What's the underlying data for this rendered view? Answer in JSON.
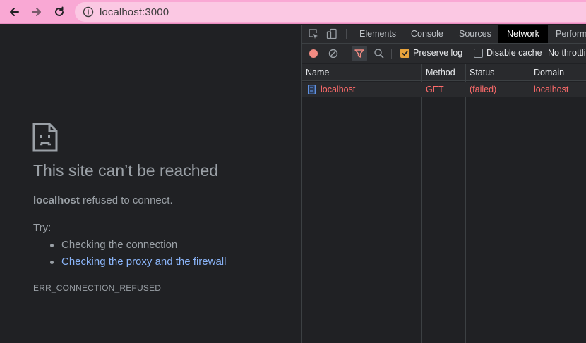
{
  "browser": {
    "url": "localhost:3000",
    "nav_icons": [
      "arrow-left-icon",
      "arrow-right-icon",
      "reload-icon",
      "info-icon"
    ]
  },
  "error_page": {
    "title": "This site can’t be reached",
    "host": "localhost",
    "message": " refused to connect.",
    "try_label": "Try:",
    "suggestions": [
      "Checking the connection",
      "Checking the proxy and the firewall"
    ],
    "error_code": "ERR_CONNECTION_REFUSED",
    "link_color": "#8ab4f8"
  },
  "devtools": {
    "tabs": [
      "Elements",
      "Console",
      "Sources",
      "Network",
      "Perform"
    ],
    "active_tab": "Network",
    "toolbar": {
      "preserve_log_label": "Preserve log",
      "preserve_log_checked": true,
      "disable_cache_label": "Disable cache",
      "disable_cache_checked": false,
      "throttling_label": "No throttlin"
    },
    "columns": [
      "Name",
      "Method",
      "Status",
      "Domain"
    ],
    "rows": [
      {
        "name": "localhost",
        "method": "GET",
        "status": "(failed)",
        "domain": "localhost"
      }
    ],
    "error_color": "#ff6b6b",
    "record_color": "#f28b82",
    "checkbox_color": "#e8a33c"
  }
}
